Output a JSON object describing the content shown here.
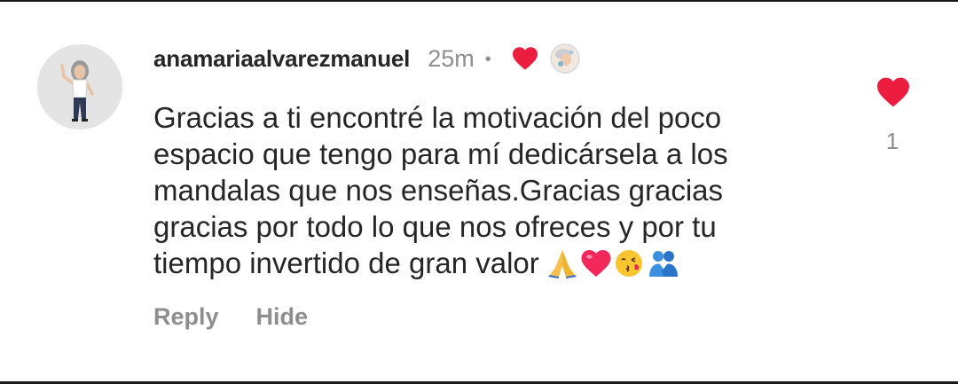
{
  "comment": {
    "username": "anamariaalvarezmanuel",
    "timestamp": "25m",
    "separator": "•",
    "creator_liked_icon": "red-heart-icon",
    "creator_avatar_icon": "creator-avatar",
    "text": "Gracias a ti encontré la motivación del poco\nespacio que tengo para mí dedicársela a los\nmandalas que nos enseñas.Gracias gracias\ngracias por todo lo que nos ofreces y por tu\ntiempo invertido de gran valor",
    "emojis": [
      "🙏",
      "❤️",
      "😘",
      "🫂"
    ],
    "actions": {
      "reply": "Reply",
      "hide": "Hide"
    },
    "likes": {
      "icon": "heart-icon",
      "count": "1",
      "color": "#ed1d3f"
    }
  },
  "colors": {
    "primary_text": "#262626",
    "secondary_text": "#8e8e8e",
    "heart": "#ed1d3f",
    "avatar_bg": "#e4e4e4"
  }
}
